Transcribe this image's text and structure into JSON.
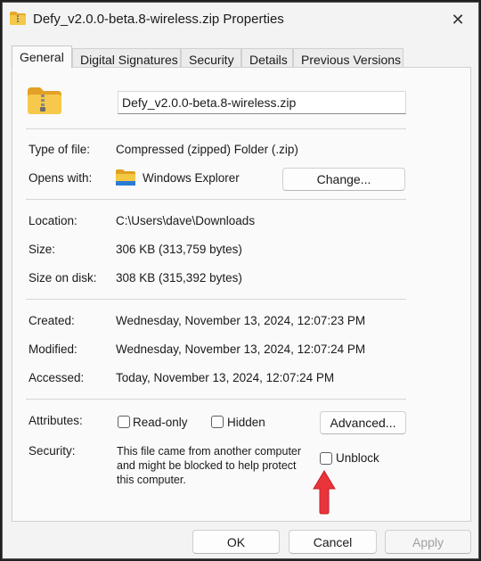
{
  "window": {
    "title": "Defy_v2.0.0-beta.8-wireless.zip Properties"
  },
  "tabs": [
    {
      "label": "General"
    },
    {
      "label": "Digital Signatures"
    },
    {
      "label": "Security"
    },
    {
      "label": "Details"
    },
    {
      "label": "Previous Versions"
    }
  ],
  "general": {
    "filename": "Defy_v2.0.0-beta.8-wireless.zip",
    "type_label": "Type of file:",
    "type_value": "Compressed (zipped) Folder (.zip)",
    "opens_label": "Opens with:",
    "opens_value": "Windows Explorer",
    "change_button": "Change...",
    "location_label": "Location:",
    "location_value": "C:\\Users\\dave\\Downloads",
    "size_label": "Size:",
    "size_value": "306 KB (313,759 bytes)",
    "size_disk_label": "Size on disk:",
    "size_disk_value": "308 KB (315,392 bytes)",
    "created_label": "Created:",
    "created_value": "Wednesday, November 13, 2024, 12:07:23 PM",
    "modified_label": "Modified:",
    "modified_value": "Wednesday, November 13, 2024, 12:07:24 PM",
    "accessed_label": "Accessed:",
    "accessed_value": "Today, November 13, 2024, 12:07:24 PM",
    "attributes_label": "Attributes:",
    "readonly_label": "Read-only",
    "hidden_label": "Hidden",
    "advanced_button": "Advanced...",
    "security_label": "Security:",
    "security_line1": "This file came from another computer",
    "security_line2": "and might be blocked to help protect",
    "security_line3": "this computer.",
    "unblock_label": "Unblock"
  },
  "footer": {
    "ok": "OK",
    "cancel": "Cancel",
    "apply": "Apply"
  },
  "colors": {
    "annotation_arrow": "#e8343a",
    "folder": "#f2c33d"
  }
}
